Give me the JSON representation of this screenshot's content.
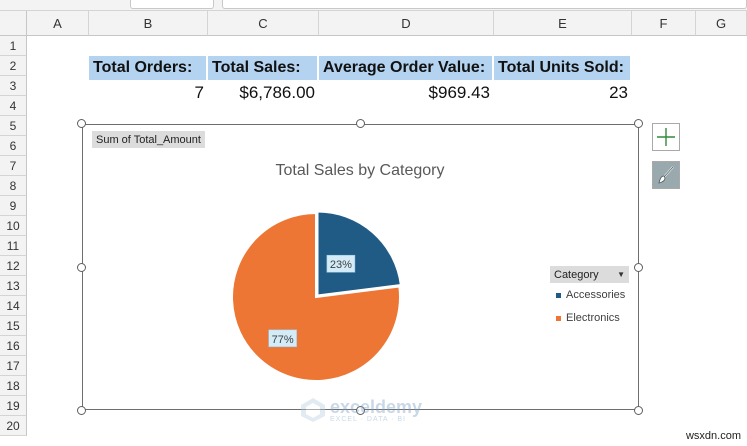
{
  "columns": [
    "A",
    "B",
    "C",
    "D",
    "E",
    "F",
    "G"
  ],
  "rows": [
    "1",
    "2",
    "3",
    "4",
    "5",
    "6",
    "7",
    "8",
    "9",
    "10",
    "11",
    "12",
    "13",
    "14",
    "15",
    "16",
    "17",
    "18",
    "19",
    "20"
  ],
  "summary": {
    "headers": [
      "Total Orders:",
      "Total Sales:",
      "Average Order Value:",
      "Total Units Sold:"
    ],
    "values": [
      "7",
      "$6,786.00",
      "$969.43",
      "23"
    ]
  },
  "chart": {
    "field_button": "Sum of Total_Amount",
    "legend_title": "Category",
    "chart_data": {
      "type": "pie",
      "title": "Total Sales by Category",
      "categories": [
        "Accessories",
        "Electronics"
      ],
      "values": [
        23,
        77
      ],
      "data_labels": [
        "23%",
        "77%"
      ],
      "colors": [
        "#1f5b85",
        "#ed7634"
      ],
      "legend": "right"
    }
  },
  "side_buttons": {
    "elements_icon": "plus-icon",
    "styles_icon": "brush-icon"
  },
  "watermark": {
    "name": "exceldemy",
    "sub": "EXCEL · DATA · BI"
  },
  "site_credit": "wsxdn.com"
}
